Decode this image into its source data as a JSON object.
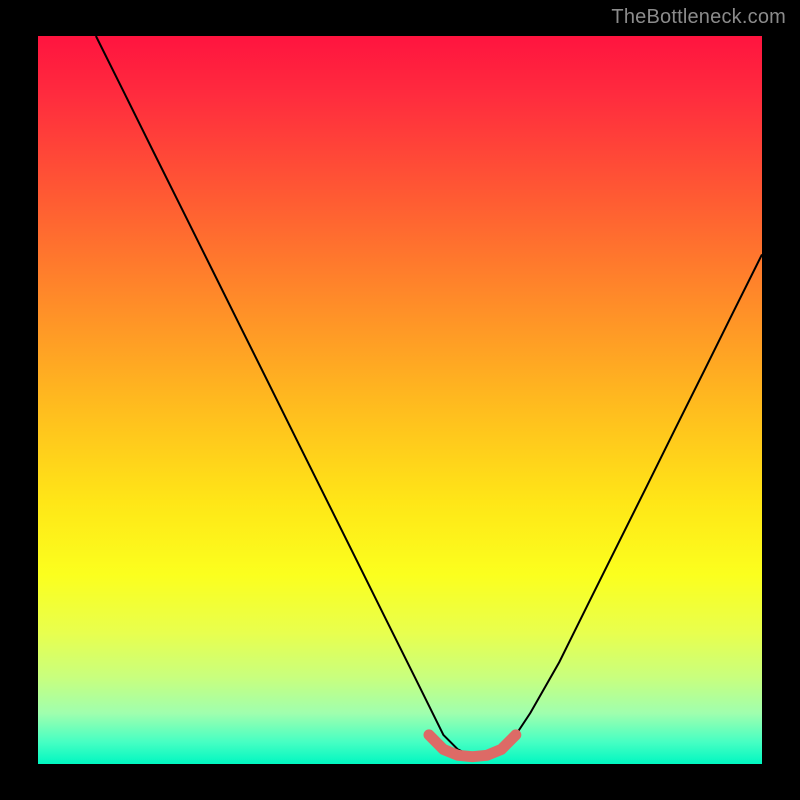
{
  "watermark": "TheBottleneck.com",
  "chart_data": {
    "type": "line",
    "title": "",
    "xlabel": "",
    "ylabel": "",
    "xlim": [
      0,
      100
    ],
    "ylim": [
      0,
      100
    ],
    "grid": false,
    "series": [
      {
        "name": "bottleneck-curve",
        "x": [
          8,
          12,
          16,
          20,
          24,
          28,
          32,
          36,
          40,
          44,
          48,
          52,
          54,
          56,
          58,
          60,
          62,
          64,
          66,
          68,
          72,
          76,
          80,
          84,
          88,
          92,
          96,
          100
        ],
        "y": [
          100,
          92,
          84,
          76,
          68,
          60,
          52,
          44,
          36,
          28,
          20,
          12,
          8,
          4,
          2,
          1,
          1,
          2,
          4,
          7,
          14,
          22,
          30,
          38,
          46,
          54,
          62,
          70
        ]
      }
    ],
    "highlight": {
      "name": "optimal-band",
      "x": [
        54,
        56,
        58,
        60,
        62,
        64,
        66
      ],
      "y": [
        4,
        2,
        1.2,
        1,
        1.2,
        2,
        4
      ]
    },
    "colors": {
      "curve": "#000000",
      "highlight": "#dd6a66",
      "gradient_top": "#ff143f",
      "gradient_bottom": "#00f7c1"
    }
  }
}
